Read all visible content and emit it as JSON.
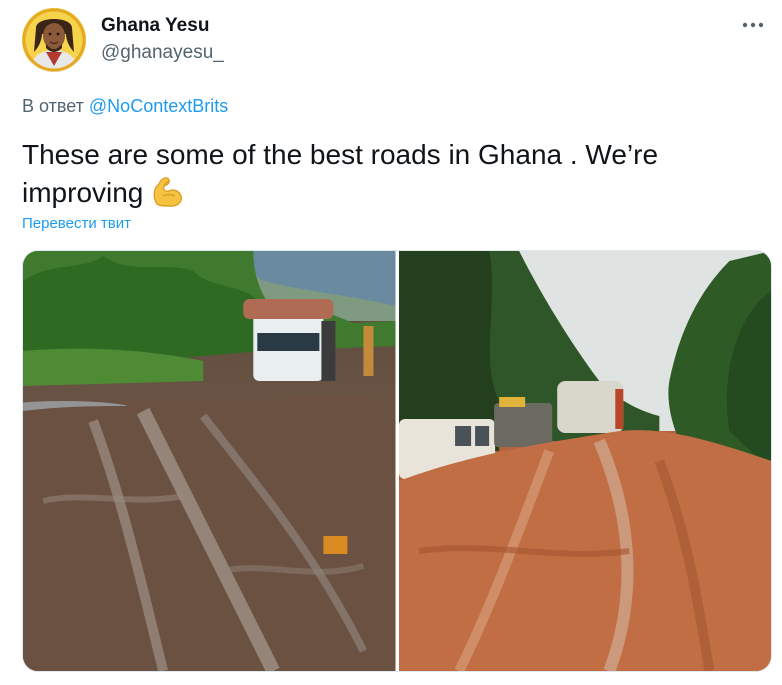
{
  "tweet": {
    "author": {
      "display_name": "Ghana Yesu",
      "handle": "@ghanayesu_",
      "avatar_icon": "avatar-portrait"
    },
    "reply": {
      "prefix": "В ответ",
      "to_handle": "@NoContextBrits"
    },
    "text": {
      "line1": "These are some of the best roads in Ghana . We’re",
      "line2": "improving",
      "emoji": "flexed-biceps"
    },
    "translate_label": "Перевести твит",
    "more_icon": "more-horizontal-icon",
    "media": [
      {
        "description_icon": "photo-muddy-road-left"
      },
      {
        "description_icon": "photo-muddy-road-right"
      }
    ]
  },
  "colors": {
    "link": "#1d9bf0",
    "secondary_text": "#536471",
    "primary_text": "#0f1419"
  }
}
